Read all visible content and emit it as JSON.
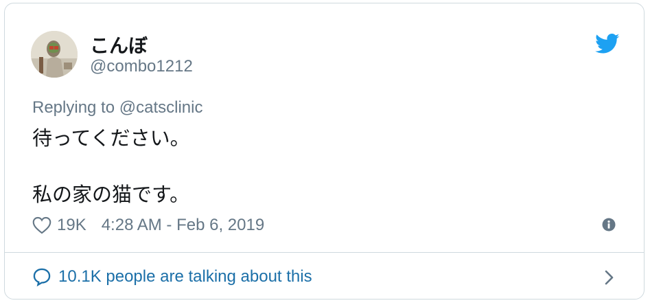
{
  "user": {
    "display_name": "こんぼ",
    "handle": "@combo1212"
  },
  "tweet": {
    "reply_prefix": "Replying to",
    "reply_to": "@catsclinic",
    "lines": [
      "待ってください。",
      "",
      "私の家の猫です。"
    ],
    "likes": "19K",
    "timestamp": "4:28 AM - Feb 6, 2019"
  },
  "footer": {
    "conversation_text": "10.1K people are talking about this"
  },
  "icons": {
    "brand": "twitter-bird-icon",
    "like": "heart-icon",
    "info": "info-icon",
    "conversation": "speech-bubble-icon",
    "navigate": "chevron-right-icon"
  },
  "colors": {
    "twitter_blue": "#1da1f2",
    "link": "#1b6fa8",
    "secondary_text": "#657786",
    "primary_text": "#14171a",
    "border": "#cfd9de"
  }
}
